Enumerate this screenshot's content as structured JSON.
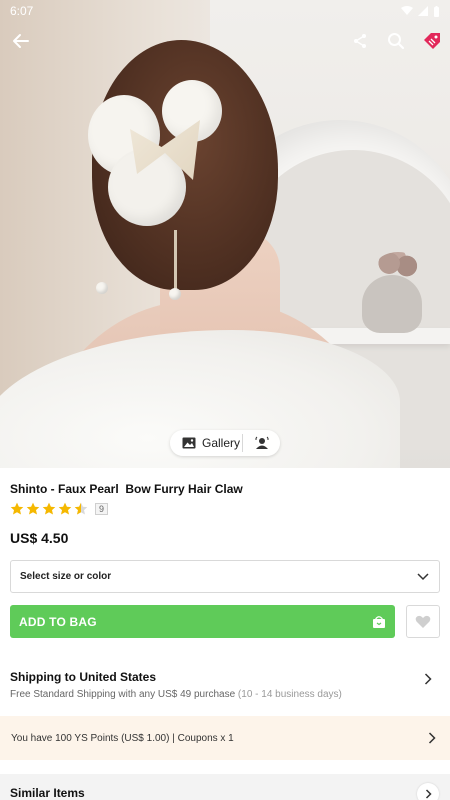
{
  "status_bar": {
    "time": "6:07",
    "icons": [
      "wifi-icon",
      "signal-icon",
      "battery-icon"
    ]
  },
  "toolbar": {
    "icons": [
      "back-arrow-icon",
      "share-icon",
      "search-icon",
      "sale-tag-icon"
    ]
  },
  "hero": {
    "gallery_label": "Gallery",
    "icons": [
      "image-icon",
      "model-icon"
    ]
  },
  "product": {
    "title": "Shinto - Faux Pearl  Bow Furry Hair Claw",
    "rating": 4.5,
    "rating_count": "9",
    "price": "US$ 4.50"
  },
  "options": {
    "select_label": "Select size or color"
  },
  "actions": {
    "add_to_bag": "ADD TO BAG"
  },
  "shipping": {
    "title": "Shipping to United States",
    "subtitle": "Free Standard Shipping with any US$ 49 purchase",
    "days": "(10 - 14 business days)"
  },
  "points": {
    "text": "You have 100 YS Points (US$ 1.00) | Coupons x 1"
  },
  "similar": {
    "title": "Similar Items"
  },
  "colors": {
    "green": "#5fcb59",
    "star": "#f5b800",
    "points_bg": "#fdf4ea",
    "tag": "#e2285a"
  }
}
